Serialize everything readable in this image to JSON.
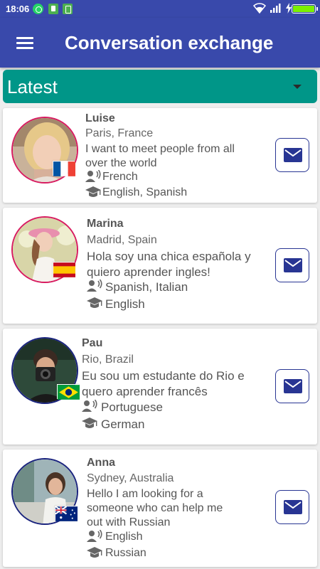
{
  "status_bar": {
    "time": "18:06",
    "icons": [
      "whatsapp-icon",
      "clipboard-icon",
      "battery-saver-icon",
      "wifi-icon",
      "signal-icon",
      "charging-icon",
      "battery-icon"
    ],
    "battery_level": 1.0
  },
  "app_bar": {
    "title": "Conversation exchange",
    "menu_icon": "menu-icon"
  },
  "filter": {
    "selected": "Latest",
    "icon": "dropdown-arrow-icon"
  },
  "colors": {
    "primary": "#3949ab",
    "accent": "#009688",
    "mail": "#283593",
    "avatar_border_female": "#d81b60",
    "avatar_border_male": "#1a237e"
  },
  "users": [
    {
      "name": "Luise",
      "location": "Paris, France",
      "message": [
        "I want to meet people from all",
        "over the world"
      ],
      "speaks": "French",
      "learns": "English, Spanish",
      "flag": "france-flag"
    },
    {
      "name": "Marina",
      "location": "Madrid, Spain",
      "message": [
        "Hola soy una chica española y",
        "quiero aprender ingles!"
      ],
      "speaks": "Spanish, Italian",
      "learns": "English",
      "flag": "spain-flag"
    },
    {
      "name": "Pau",
      "location": "Rio, Brazil",
      "message": [
        "Eu sou um estudante do Rio e",
        "quero aprender francês"
      ],
      "speaks": "Portuguese",
      "learns": "German",
      "flag": "brazil-flag"
    },
    {
      "name": "Anna",
      "location": "Sydney, Australia",
      "message": [
        "Hello I am looking for a",
        "someone who can help me",
        "out with Russian"
      ],
      "speaks": "English",
      "learns": "Russian",
      "flag": "australia-flag"
    }
  ]
}
